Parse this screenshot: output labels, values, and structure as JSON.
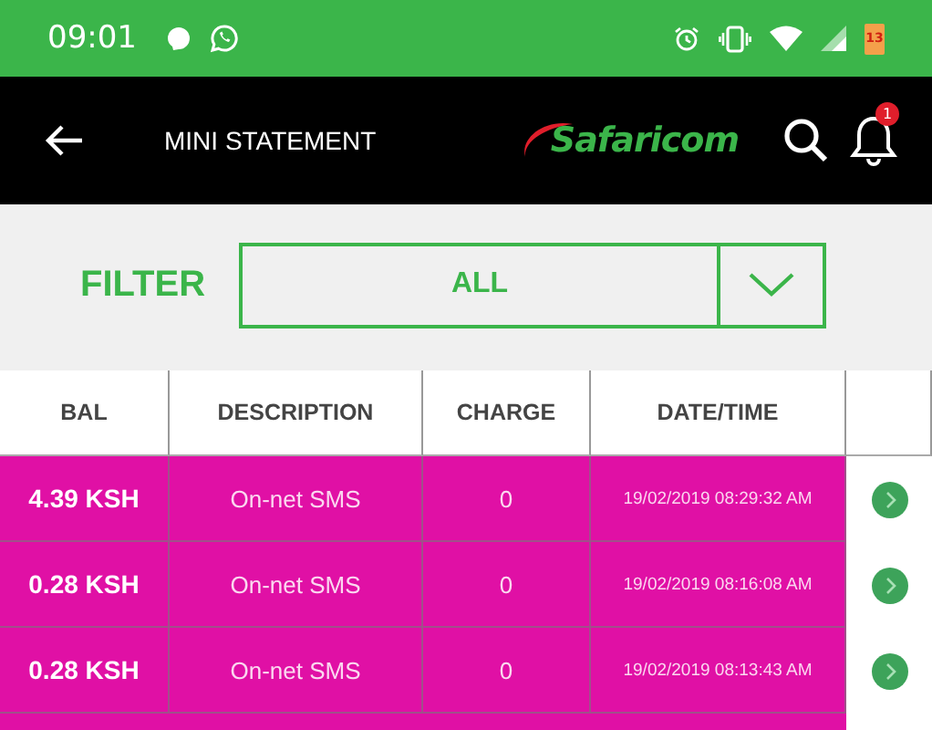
{
  "status_bar": {
    "time": "09:01",
    "battery": "13"
  },
  "header": {
    "title": "MINI STATEMENT",
    "logo": "Safaricom",
    "notification_count": "1"
  },
  "filter": {
    "label": "FILTER",
    "value": "ALL"
  },
  "table": {
    "columns": [
      "BAL",
      "DESCRIPTION",
      "CHARGE",
      "DATE/TIME"
    ],
    "rows": [
      {
        "bal": "4.39 KSH",
        "description": "On-net SMS",
        "charge": "0",
        "datetime": "19/02/2019 08:29:32 AM"
      },
      {
        "bal": "0.28 KSH",
        "description": "On-net SMS",
        "charge": "0",
        "datetime": "19/02/2019 08:16:08 AM"
      },
      {
        "bal": "0.28 KSH",
        "description": "On-net SMS",
        "charge": "0",
        "datetime": "19/02/2019 08:13:43 AM"
      }
    ]
  }
}
